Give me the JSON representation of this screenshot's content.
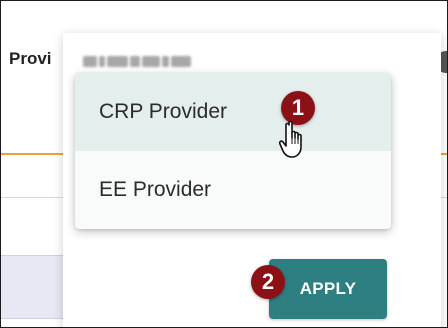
{
  "background": {
    "label": "Provi"
  },
  "dropdown": {
    "items": [
      {
        "label": "CRP Provider",
        "highlighted": true
      },
      {
        "label": "EE Provider",
        "highlighted": false
      }
    ]
  },
  "annotations": {
    "step1": "1",
    "step2": "2"
  },
  "actions": {
    "apply_label": "APPLY"
  },
  "colors": {
    "accent": "#2e7f82",
    "badge": "#8b1117",
    "highlight": "#e4eeec",
    "orange_line": "#e8a33c"
  },
  "icons": {
    "cursor": "hand-pointer-icon"
  }
}
